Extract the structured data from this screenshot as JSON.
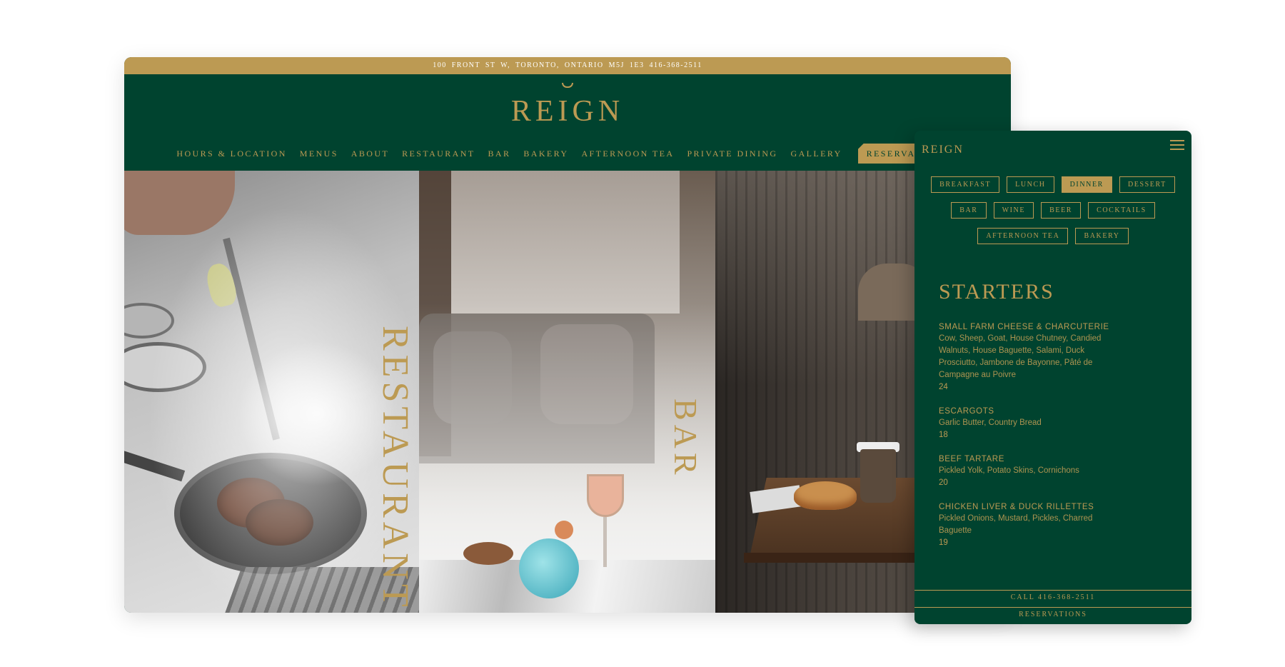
{
  "desktop": {
    "address_bar": "100 FRONT ST W, TORONTO, ONTARIO M5J 1E3    416-368-2511",
    "logo": "REIGN",
    "nav": [
      "HOURS & LOCATION",
      "MENUS",
      "ABOUT",
      "RESTAURANT",
      "BAR",
      "BAKERY",
      "AFTERNOON TEA",
      "PRIVATE DINING",
      "GALLERY"
    ],
    "nav_cta": "RESERVATIONS",
    "panels": {
      "restaurant_label": "RESTAURANT",
      "bar_label": "BAR"
    }
  },
  "mobile": {
    "logo": "REIGN",
    "menu_icon": "hamburger-icon",
    "categories_row1": [
      "BREAKFAST",
      "LUNCH",
      "DINNER",
      "DESSERT"
    ],
    "categories_row2": [
      "BAR",
      "WINE",
      "BEER",
      "COCKTAILS"
    ],
    "categories_row3": [
      "AFTERNOON TEA",
      "BAKERY"
    ],
    "active_category": "DINNER",
    "section_title": "STARTERS",
    "items": [
      {
        "name": "SMALL FARM CHEESE & CHARCUTERIE",
        "description": "Cow, Sheep, Goat, House Chutney, Candied Walnuts, House Baguette, Salami, Duck Prosciutto, Jambone de Bayonne, Pâté de Campagne au Poivre",
        "price": "24"
      },
      {
        "name": "ESCARGOTS",
        "description": "Garlic Butter, Country Bread",
        "price": "18"
      },
      {
        "name": "BEEF TARTARE",
        "description": "Pickled Yolk, Potato Skins, Cornichons",
        "price": "20"
      },
      {
        "name": "CHICKEN LIVER & DUCK RILLETTES",
        "description": "Pickled Onions, Mustard, Pickles, Charred Baguette",
        "price": "19"
      }
    ],
    "call_button": "CALL 416-368-2511",
    "reservations_button": "RESERVATIONS"
  },
  "colors": {
    "brand_green": "#00432f",
    "brand_gold": "#bc9a53"
  }
}
